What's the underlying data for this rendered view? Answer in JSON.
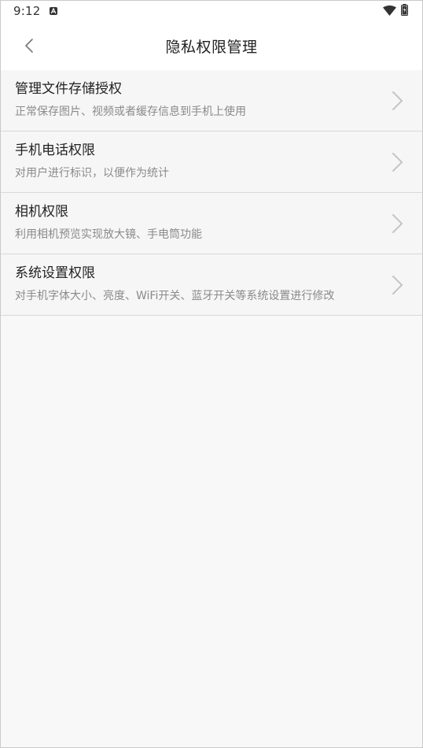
{
  "status_bar": {
    "time": "9:12"
  },
  "header": {
    "title": "隐私权限管理"
  },
  "permissions": [
    {
      "title": "管理文件存储授权",
      "description": "正常保存图片、视频或者缓存信息到手机上使用"
    },
    {
      "title": "手机电话权限",
      "description": "对用户进行标识，以便作为统计"
    },
    {
      "title": "相机权限",
      "description": "利用相机预览实现放大镜、手电筒功能"
    },
    {
      "title": "系统设置权限",
      "description": "对手机字体大小、亮度、WiFi开关、蓝牙开关等系统设置进行修改"
    }
  ],
  "colors": {
    "background": "#f8f8f8",
    "title_text": "#222222",
    "desc_text": "#8a8a8a",
    "divider": "#d9d9d9",
    "chevron": "#c4c4c4"
  }
}
